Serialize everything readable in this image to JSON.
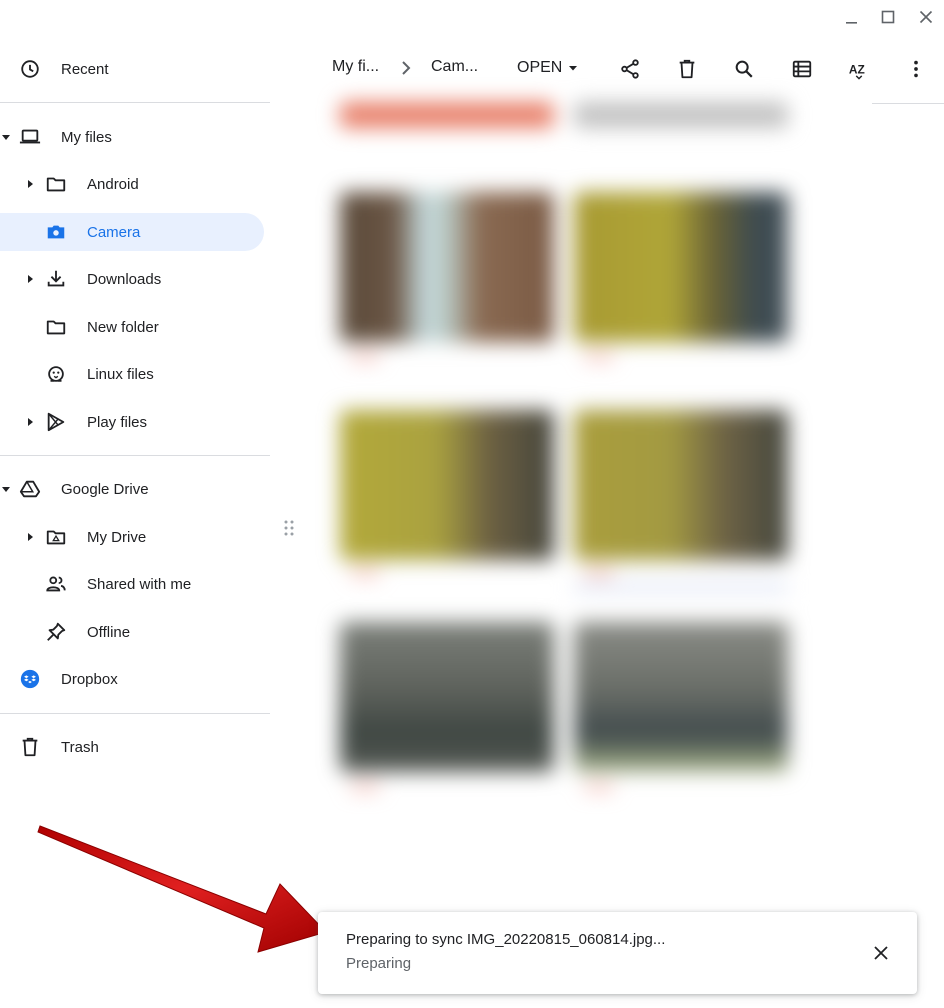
{
  "window": {
    "minimize_icon": "minimize-icon",
    "maximize_icon": "maximize-icon",
    "close_icon": "close-icon"
  },
  "sidebar": {
    "recent": "Recent",
    "my_files": "My files",
    "android": "Android",
    "camera": "Camera",
    "downloads": "Downloads",
    "new_folder": "New folder",
    "linux_files": "Linux files",
    "play_files": "Play files",
    "google_drive": "Google Drive",
    "my_drive": "My Drive",
    "shared_with_me": "Shared with me",
    "offline": "Offline",
    "dropbox": "Dropbox",
    "trash": "Trash"
  },
  "toolbar": {
    "crumb_root": "My fi...",
    "crumb_current": "Cam...",
    "open_label": "OPEN",
    "icons": [
      "share-icon",
      "delete-icon",
      "search-icon",
      "list-view-icon",
      "sort-icon",
      "more-icon"
    ]
  },
  "toast": {
    "title": "Preparing to sync IMG_20220815_060814.jpg...",
    "subtitle": "Preparing"
  },
  "colors": {
    "accent": "#1a73e8",
    "selected_bg": "#e8f0fe",
    "arrow": "#d01010"
  }
}
